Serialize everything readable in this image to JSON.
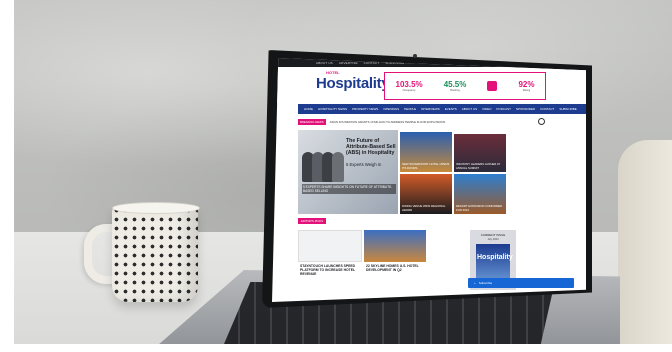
{
  "topbar": {
    "links": [
      "ABOUT US",
      "ADVERTISE",
      "CONTACT",
      "SUBSCRIBE"
    ]
  },
  "header": {
    "logo_small": "HOTEL",
    "logo_main": "Hospitality",
    "stats": [
      {
        "value": "103.5%",
        "label": "Occupancy"
      },
      {
        "value": "45.5%",
        "label": "Booking"
      },
      {
        "value": "92%",
        "label": "Rating"
      }
    ]
  },
  "nav": {
    "items": [
      "HOME",
      "HOSPITALITY NEWS",
      "PROPERTY NEWS",
      "OPENINGS",
      "PEOPLE",
      "INTERVIEWS",
      "EVENTS",
      "ABOUT US",
      "VIDEO",
      "PODCAST",
      "SPONSORED",
      "CONTACT",
      "SUBSCRIBE"
    ]
  },
  "ticker": {
    "tag": "BREAKING NEWS",
    "text": "ASIAN FOUNDATION GRANTS 10 MILLION TO ADDRESS TEMPLE FLOOR EXPLOSIONS"
  },
  "hero": {
    "title": "The Future of Attribute-Based Sell (ABS) in Hospitality",
    "subtitle": "5 Experts Weigh In",
    "caption": "5 EXPERTS SHARE INSIGHTS ON FUTURE OF ATTRIBUTE-BASED SELLING"
  },
  "tiles": [
    {
      "caption": "NEW WATERFRONT HOTEL OPENS ITS DOORS"
    },
    {
      "caption": "INDUSTRY LEADERS GATHER AT ANNUAL SUMMIT"
    },
    {
      "caption": "DINING VENUE WINS REGIONAL AWARD"
    },
    {
      "caption": "RESORT EXPANSION CONFIRMED FOR 2024"
    }
  ],
  "section": {
    "tag": "EDITOR'S PICKS"
  },
  "cards": [
    {
      "title": "STAYNTOUCH LAUNCHES SPEED PLATFORM TO INCREASE HOTEL REVENUE"
    },
    {
      "title": "22 SKYLINE HOMES U.S. HOTEL DEVELOPMENT IN Q2"
    }
  ],
  "issue": {
    "heading": "CURRENT ISSUE",
    "date": "July 2023",
    "logo": "Hospitality"
  },
  "cta": {
    "label": "Subscribe"
  }
}
